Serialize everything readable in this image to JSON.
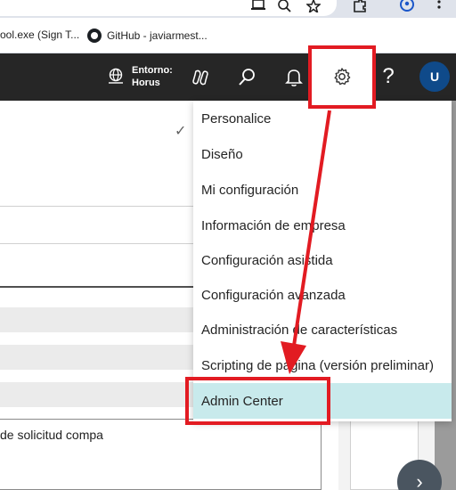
{
  "browser": {
    "bookmarks": [
      {
        "label": "ool.exe (Sign T..."
      },
      {
        "label": "GitHub - javiarmest..."
      }
    ],
    "icons": [
      "cast-icon",
      "zoom-icon",
      "star-icon",
      "extensions-icon",
      "profile-icon",
      "more-icon"
    ]
  },
  "appbar": {
    "environment_label": "Entorno:",
    "environment_value": "Horus",
    "help_label": "?",
    "avatar_initial": "U"
  },
  "page": {
    "textbox_value": "de solicitud compa"
  },
  "menu": {
    "items": [
      {
        "label": "Personalice"
      },
      {
        "label": "Diseño"
      },
      {
        "label": "Mi configuración"
      },
      {
        "label": "Información de empresa"
      },
      {
        "label": "Configuración asistida"
      },
      {
        "label": "Configuración avanzada"
      },
      {
        "label": "Administración de características"
      },
      {
        "label": "Scripting de página (versión preliminar)"
      },
      {
        "label": "Admin Center",
        "highlighted": true
      }
    ]
  },
  "colors": {
    "appbar_bg": "#262626",
    "annotation_red": "#e21b22",
    "highlight": "#c8eaec",
    "avatar_bg": "#0f4a8a"
  }
}
